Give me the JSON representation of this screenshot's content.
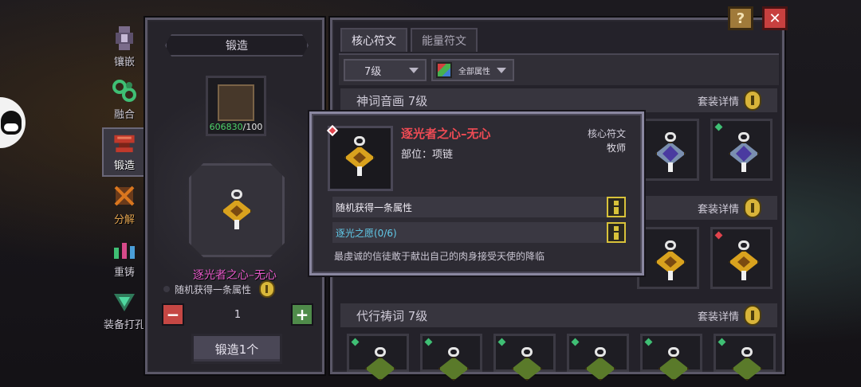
{
  "left_tabs": [
    {
      "label": "镶嵌",
      "icon": "socket-icon"
    },
    {
      "label": "融合",
      "icon": "fusion-icon"
    },
    {
      "label": "锻造",
      "icon": "anvil-icon"
    },
    {
      "label": "分解",
      "icon": "decompose-icon"
    },
    {
      "label": "重铸",
      "icon": "recast-icon"
    },
    {
      "label": "装备打孔",
      "icon": "drill-icon"
    }
  ],
  "forge": {
    "title": "锻造",
    "material_have": "606830",
    "material_need": "/100",
    "item_name": "逐光者之心–无心",
    "attr_text": "随机获得一条属性",
    "quantity": "1",
    "button": "锻造1个"
  },
  "rune_panel": {
    "tabs": [
      "核心符文",
      "能量符文"
    ],
    "level_dropdown": "7级",
    "attr_dropdown": "全部属性",
    "sets": [
      {
        "name": "神词音画 7级",
        "detail": "套装详情"
      },
      {
        "name": "",
        "detail": "套装详情"
      },
      {
        "name": "代行祷词 7级",
        "detail": "套装详情"
      }
    ]
  },
  "top_buttons": {
    "help": "?",
    "close": "✕"
  },
  "tooltip": {
    "name": "逐光者之心–无心",
    "slot": "部位：项链",
    "type": "核心符文",
    "class": "牧师",
    "row1": "随机获得一条属性",
    "row2": "逐光之愿(0/6)",
    "description": "最虔诚的信徒敢于献出自己的肉身接受天使的降临"
  },
  "colors": {
    "item_name_forge": "#e65ac9",
    "item_name_tooltip": "#ef4b54",
    "set_bonus": "#61c9e8",
    "material_count": "#4ed36a"
  }
}
